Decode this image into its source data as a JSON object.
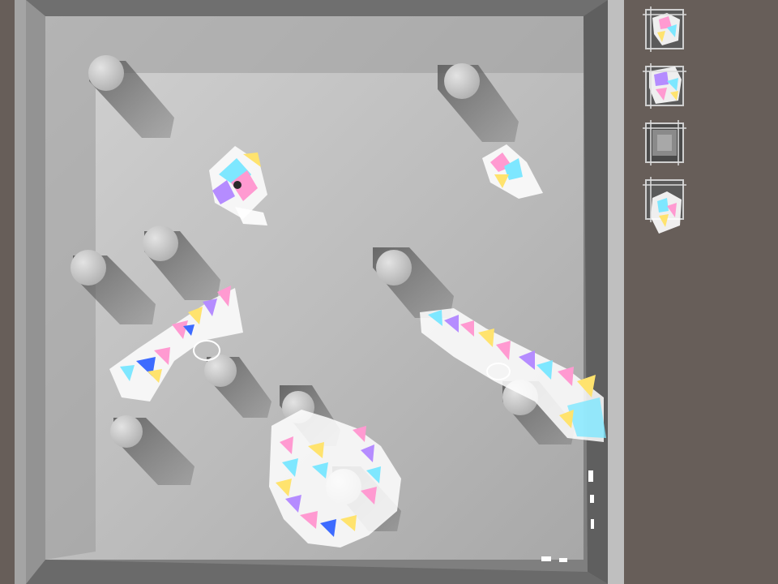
{
  "scene": {
    "floor_color": "#b5b5b5",
    "wall_color": "#8f8f8f",
    "background_color": "#675e59",
    "pillar_color": "#c9c9c9",
    "shadow_color": "#6e6e6e",
    "debris_palette": [
      "#ff9ad1",
      "#ffe36e",
      "#7ee7ff",
      "#b58cff",
      "#7cffb0",
      "#ffffff",
      "#3d6bff"
    ]
  },
  "sidebar": {
    "thumbnails": [
      {
        "name": "thumb-debris-top",
        "content": "debris-icon"
      },
      {
        "name": "thumb-debris-bottom",
        "content": "debris-icon"
      },
      {
        "name": "thumb-empty",
        "content": "empty-box-icon"
      },
      {
        "name": "thumb-debris-small",
        "content": "debris-icon"
      }
    ]
  }
}
